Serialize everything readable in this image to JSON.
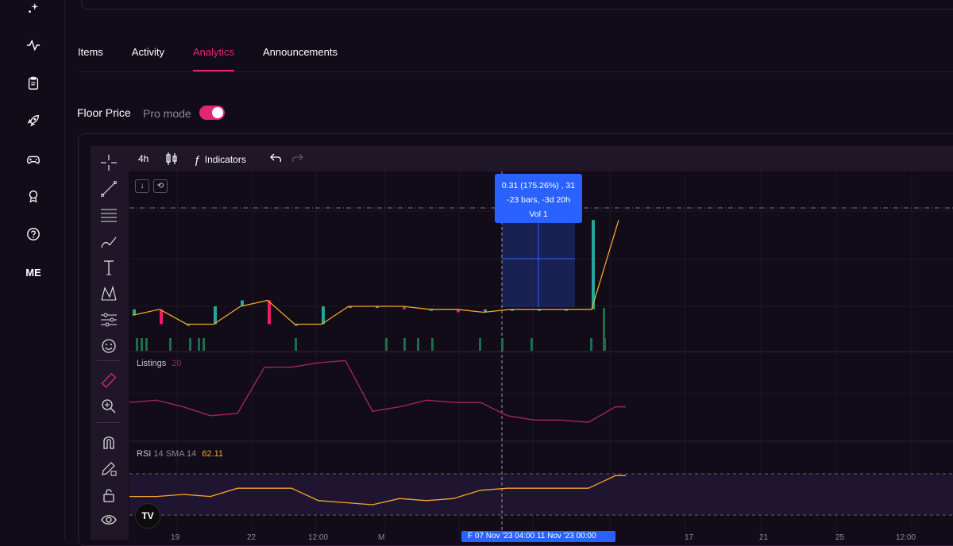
{
  "tabs": [
    {
      "label": "Items"
    },
    {
      "label": "Activity"
    },
    {
      "label": "Analytics",
      "active": true
    },
    {
      "label": "Announcements"
    }
  ],
  "floor_price": {
    "title": "Floor Price",
    "pro_mode_label": "Pro mode",
    "pro_mode_on": true
  },
  "toolbar": {
    "interval": "4h",
    "indicators_label": "Indicators"
  },
  "measure_tooltip": {
    "line1": "0.31 (175.26%) , 31",
    "line2": "-23 bars, -3d 20h",
    "line3": "Vol 1"
  },
  "panes": {
    "listings": {
      "label": "Listings",
      "value": "20"
    },
    "rsi": {
      "label": "RSI",
      "params": "14 SMA 14",
      "value": "62.11"
    }
  },
  "xaxis": {
    "ticks": [
      "19",
      "22",
      "12:00",
      "M",
      "17",
      "21",
      "25",
      "12:00"
    ],
    "crosshair_label": "F 07 Nov '23 04:00  11 Nov '23 00:00"
  },
  "logo_text": "ME",
  "tv_logo_text": "TV",
  "colors": {
    "accent": "#e42575",
    "up": "#26a69a",
    "down": "#e91e63",
    "ma": "#f5a623",
    "listings": "#a3245a",
    "rsi": "#f5a623",
    "measure": "#2962ff"
  },
  "chart_data": [
    {
      "type": "line",
      "name": "Floor Price candles",
      "x": [
        0,
        5,
        10,
        15,
        20,
        25,
        30,
        35,
        40,
        45,
        50,
        55,
        60,
        65,
        70,
        75,
        80,
        85,
        90
      ],
      "values": [
        0.17,
        0.19,
        0.14,
        0.14,
        0.2,
        0.22,
        0.14,
        0.14,
        0.2,
        0.2,
        0.2,
        0.19,
        0.19,
        0.18,
        0.19,
        0.19,
        0.19,
        0.19,
        0.49
      ]
    },
    {
      "type": "line",
      "name": "Listings",
      "values": [
        24,
        25,
        22,
        18,
        19,
        40,
        40,
        42,
        43,
        20,
        22,
        25,
        24,
        24,
        18,
        16,
        16,
        15,
        22
      ]
    },
    {
      "type": "line",
      "name": "RSI",
      "values": [
        52,
        52,
        53,
        52,
        56,
        56,
        56,
        50,
        49,
        48,
        51,
        50,
        51,
        55,
        56,
        56,
        56,
        56,
        62.11
      ]
    }
  ]
}
